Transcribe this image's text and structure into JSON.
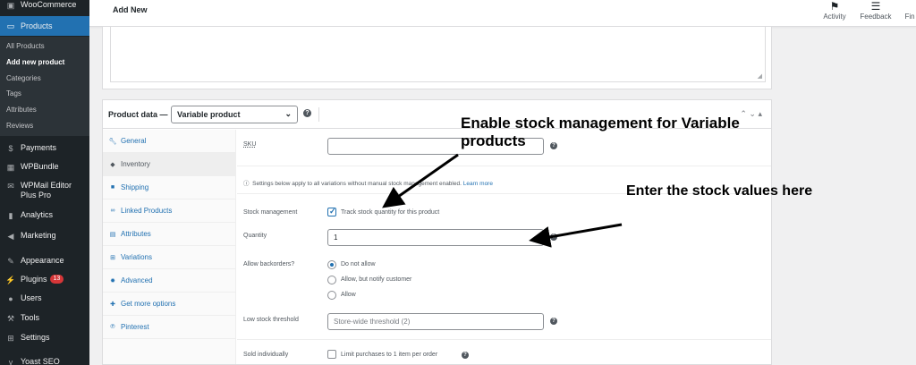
{
  "sidebar": {
    "woocommerce": "WooCommerce",
    "products": "Products",
    "submenu": [
      "All Products",
      "Add new product",
      "Categories",
      "Tags",
      "Attributes",
      "Reviews"
    ],
    "items": [
      {
        "label": "Payments"
      },
      {
        "label": "WPBundle"
      },
      {
        "label": "WPMail Editor Plus Pro"
      },
      {
        "label": "Analytics"
      },
      {
        "label": "Marketing"
      },
      {
        "label": "Appearance"
      },
      {
        "label": "Plugins",
        "badge": "13"
      },
      {
        "label": "Users"
      },
      {
        "label": "Tools"
      },
      {
        "label": "Settings"
      },
      {
        "label": "Yoast SEO"
      }
    ]
  },
  "topbar": {
    "title": "Add New",
    "activity": "Activity",
    "feedback": "Feedback",
    "finish": "Fin"
  },
  "product_data": {
    "title": "Product data —",
    "type_value": "Variable product",
    "help": "?",
    "toggles": "⌃ ⌄ ▴",
    "tabs": [
      "General",
      "Inventory",
      "Shipping",
      "Linked Products",
      "Attributes",
      "Variations",
      "Advanced",
      "Get more options",
      "Pinterest"
    ],
    "active_tab": "Inventory",
    "sku_label": "SKU",
    "sku_value": "",
    "notice": "Settings below apply to all variations without manual stock management enabled.",
    "notice_link": "Learn more",
    "stock_mgmt_label": "Stock management",
    "stock_mgmt_checkbox": "Track stock quantity for this product",
    "stock_mgmt_checked": true,
    "quantity_label": "Quantity",
    "quantity_value": "1",
    "backorders_label": "Allow backorders?",
    "backorder_options": [
      "Do not allow",
      "Allow, but notify customer",
      "Allow"
    ],
    "backorder_selected": 0,
    "low_stock_label": "Low stock threshold",
    "low_stock_placeholder": "Store-wide threshold (2)",
    "sold_individually_label": "Sold individually",
    "sold_individually_checkbox": "Limit purchases to 1 item per order"
  },
  "annotations": {
    "stock_mgmt": "Enable stock management for Variable products",
    "stock_values": "Enter the stock values here"
  }
}
